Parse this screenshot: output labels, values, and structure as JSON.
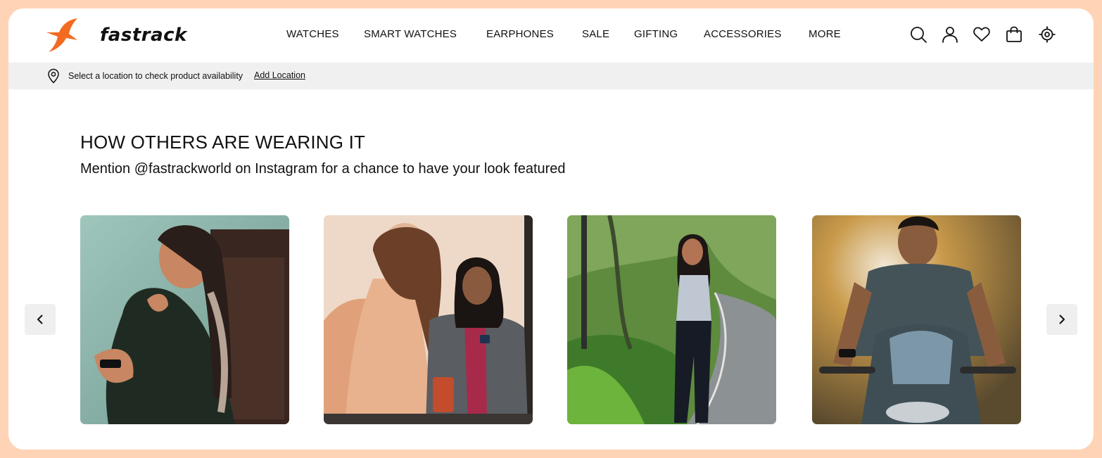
{
  "brand": {
    "name": "fastrack",
    "accent": "#F26B21"
  },
  "nav": [
    {
      "label": "WATCHES"
    },
    {
      "label": "SMART WATCHES"
    },
    {
      "label": "EARPHONES"
    },
    {
      "label": "SALE"
    },
    {
      "label": "GIFTING"
    },
    {
      "label": "ACCESSORIES"
    },
    {
      "label": "MORE"
    }
  ],
  "header_icons": [
    "search-icon",
    "account-icon",
    "wishlist-heart-icon",
    "cart-bag-icon",
    "store-locator-icon"
  ],
  "location_bar": {
    "icon": "location-pin-icon",
    "text": "Select a location to check product availability",
    "link": "Add Location"
  },
  "section": {
    "title": "HOW OTHERS ARE WEARING IT",
    "subtitle": "Mention @fastrackworld on Instagram for a chance to have your look featured"
  },
  "carousel": {
    "prev_icon": "chevron-left-icon",
    "next_icon": "chevron-right-icon",
    "photos": [
      {
        "name": "ugc-photo-woman-armchair"
      },
      {
        "name": "ugc-photo-woman-poster"
      },
      {
        "name": "ugc-photo-woman-road"
      },
      {
        "name": "ugc-photo-man-motorbike"
      }
    ]
  }
}
